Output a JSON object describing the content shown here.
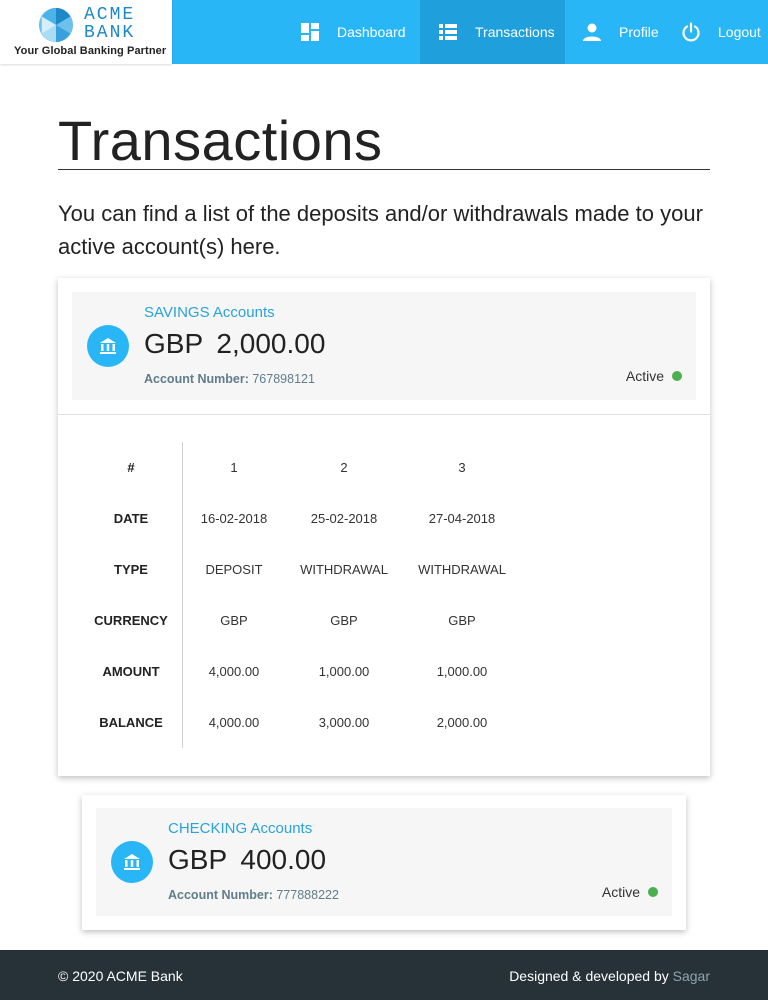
{
  "brand": {
    "line1": "ACME",
    "line2": "BANK",
    "tagline": "Your Global Banking Partner"
  },
  "nav": {
    "dashboard": "Dashboard",
    "transactions": "Transactions",
    "profile": "Profile",
    "logout": "Logout"
  },
  "page": {
    "title": "Transactions",
    "intro": "You can find a list of the deposits and/or withdrawals made to your active account(s) here."
  },
  "accounts": [
    {
      "type": "SAVINGS Accounts",
      "currency": "GBP",
      "balance": "2,000.00",
      "number_label": "Account Number:",
      "number": "767898121",
      "status": "Active",
      "transactions": {
        "headers": [
          "#",
          "DATE",
          "TYPE",
          "CURRENCY",
          "AMOUNT",
          "BALANCE"
        ],
        "columns": [
          [
            "1",
            "16-02-2018",
            "DEPOSIT",
            "GBP",
            "4,000.00",
            "4,000.00"
          ],
          [
            "2",
            "25-02-2018",
            "WITHDRAWAL",
            "GBP",
            "1,000.00",
            "3,000.00"
          ],
          [
            "3",
            "27-04-2018",
            "WITHDRAWAL",
            "GBP",
            "1,000.00",
            "2,000.00"
          ]
        ]
      }
    },
    {
      "type": "CHECKING Accounts",
      "currency": "GBP",
      "balance": "400.00",
      "number_label": "Account Number:",
      "number": "777888222",
      "status": "Active"
    }
  ],
  "footer": {
    "copyright": "© 2020 ACME Bank",
    "credit": "Designed & developed by",
    "author": "Sagar"
  },
  "colors": {
    "primary": "#29b6f6",
    "nav_active": "#1f9fdc",
    "status_active": "#4caf50",
    "footer_bg": "#263238"
  }
}
